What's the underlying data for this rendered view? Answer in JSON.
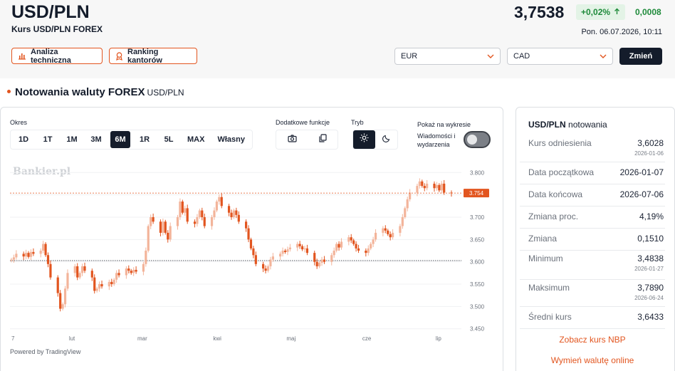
{
  "header": {
    "title": "USD/PLN",
    "subtitle": "Kurs USD/PLN FOREX",
    "price": "3,7538",
    "change_pct": "+0,02%",
    "change_abs": "0,0008",
    "datetime": "Pon. 06.07.2026, 10:11",
    "buttons": {
      "technical_label": "Analiza techniczna",
      "ranking_label": "Ranking kantorów"
    },
    "selects": {
      "from_value": "EUR",
      "to_value": "CAD"
    },
    "change_button_label": "Zmień"
  },
  "section": {
    "title": "Notowania waluty FOREX",
    "pair": "USD/PLN"
  },
  "controls": {
    "period_label": "Okres",
    "periods": [
      "1D",
      "1T",
      "1M",
      "3M",
      "6M",
      "1R",
      "5L",
      "MAX",
      "Własny"
    ],
    "active_period": "6M",
    "functions_label": "Dodatkowe funkcje",
    "mode_label": "Tryb",
    "show_label": "Pokaż na wykresie",
    "show_option": "Wiadomości i wydarzenia",
    "toggle_on": false
  },
  "chart_data": {
    "type": "candlestick",
    "watermark": "Bankier.pl",
    "x_tick_labels": [
      "7",
      "lut",
      "mar",
      "kwi",
      "maj",
      "cze",
      "lip"
    ],
    "y_tick_labels": [
      "3.800",
      "3.750",
      "3.700",
      "3.650",
      "3.600",
      "3.550",
      "3.500",
      "3.450"
    ],
    "ylim": [
      3.44,
      3.81
    ],
    "reference_line": 3.6028,
    "last_price_label": "3.754",
    "up_color": "#f3b49a",
    "down_color": "#e2551f",
    "candles": [
      {
        "date": "2026-01-07",
        "close": 3.605
      },
      {
        "date": "2026-01-08",
        "close": 3.61
      },
      {
        "date": "2026-01-09",
        "close": 3.618
      },
      {
        "date": "2026-01-12",
        "close": 3.612
      },
      {
        "date": "2026-01-13",
        "close": 3.62
      },
      {
        "date": "2026-01-14",
        "close": 3.611
      },
      {
        "date": "2026-01-15",
        "close": 3.622
      },
      {
        "date": "2026-01-16",
        "close": 3.618
      },
      {
        "date": "2026-01-19",
        "close": 3.625
      },
      {
        "date": "2026-01-20",
        "close": 3.64
      },
      {
        "date": "2026-01-21",
        "close": 3.615
      },
      {
        "date": "2026-01-22",
        "close": 3.595
      },
      {
        "date": "2026-01-23",
        "close": 3.565
      },
      {
        "date": "2026-01-26",
        "close": 3.53
      },
      {
        "date": "2026-01-27",
        "close": 3.495
      },
      {
        "date": "2026-01-28",
        "close": 3.505
      },
      {
        "date": "2026-01-29",
        "close": 3.54
      },
      {
        "date": "2026-01-30",
        "close": 3.575
      },
      {
        "date": "2026-02-02",
        "close": 3.59
      },
      {
        "date": "2026-02-03",
        "close": 3.565
      },
      {
        "date": "2026-02-04",
        "close": 3.575
      },
      {
        "date": "2026-02-05",
        "close": 3.59
      },
      {
        "date": "2026-02-06",
        "close": 3.58
      },
      {
        "date": "2026-02-09",
        "close": 3.565
      },
      {
        "date": "2026-02-10",
        "close": 3.535
      },
      {
        "date": "2026-02-11",
        "close": 3.54
      },
      {
        "date": "2026-02-12",
        "close": 3.55
      },
      {
        "date": "2026-02-13",
        "close": 3.545
      },
      {
        "date": "2026-02-16",
        "close": 3.555
      },
      {
        "date": "2026-02-17",
        "close": 3.55
      },
      {
        "date": "2026-02-18",
        "close": 3.56
      },
      {
        "date": "2026-02-19",
        "close": 3.575
      },
      {
        "date": "2026-02-20",
        "close": 3.57
      },
      {
        "date": "2026-02-23",
        "close": 3.585
      },
      {
        "date": "2026-02-24",
        "close": 3.58
      },
      {
        "date": "2026-02-25",
        "close": 3.575
      },
      {
        "date": "2026-02-26",
        "close": 3.582
      },
      {
        "date": "2026-02-27",
        "close": 3.578
      },
      {
        "date": "2026-03-02",
        "close": 3.595
      },
      {
        "date": "2026-03-03",
        "close": 3.625
      },
      {
        "date": "2026-03-04",
        "close": 3.68
      },
      {
        "date": "2026-03-05",
        "close": 3.7
      },
      {
        "date": "2026-03-06",
        "close": 3.69
      },
      {
        "date": "2026-03-09",
        "close": 3.665
      },
      {
        "date": "2026-03-10",
        "close": 3.69
      },
      {
        "date": "2026-03-11",
        "close": 3.665
      },
      {
        "date": "2026-03-12",
        "close": 3.65
      },
      {
        "date": "2026-03-13",
        "close": 3.68
      },
      {
        "date": "2026-03-16",
        "close": 3.7
      },
      {
        "date": "2026-03-17",
        "close": 3.735
      },
      {
        "date": "2026-03-18",
        "close": 3.71
      },
      {
        "date": "2026-03-19",
        "close": 3.72
      },
      {
        "date": "2026-03-20",
        "close": 3.69
      },
      {
        "date": "2026-03-23",
        "close": 3.685
      },
      {
        "date": "2026-03-24",
        "close": 3.7
      },
      {
        "date": "2026-03-25",
        "close": 3.715
      },
      {
        "date": "2026-03-26",
        "close": 3.7
      },
      {
        "date": "2026-03-27",
        "close": 3.68
      },
      {
        "date": "2026-03-30",
        "close": 3.7
      },
      {
        "date": "2026-03-31",
        "close": 3.715
      },
      {
        "date": "2026-04-01",
        "close": 3.735
      },
      {
        "date": "2026-04-02",
        "close": 3.745
      },
      {
        "date": "2026-04-03",
        "close": 3.725
      },
      {
        "date": "2026-04-06",
        "close": 3.71
      },
      {
        "date": "2026-04-07",
        "close": 3.7
      },
      {
        "date": "2026-04-08",
        "close": 3.715
      },
      {
        "date": "2026-04-09",
        "close": 3.705
      },
      {
        "date": "2026-04-10",
        "close": 3.69
      },
      {
        "date": "2026-04-13",
        "close": 3.675
      },
      {
        "date": "2026-04-14",
        "close": 3.65
      },
      {
        "date": "2026-04-15",
        "close": 3.63
      },
      {
        "date": "2026-04-16",
        "close": 3.615
      },
      {
        "date": "2026-04-17",
        "close": 3.595
      },
      {
        "date": "2026-04-20",
        "close": 3.585
      },
      {
        "date": "2026-04-21",
        "close": 3.58
      },
      {
        "date": "2026-04-22",
        "close": 3.59
      },
      {
        "date": "2026-04-23",
        "close": 3.605
      },
      {
        "date": "2026-04-24",
        "close": 3.612
      },
      {
        "date": "2026-04-27",
        "close": 3.618
      },
      {
        "date": "2026-04-28",
        "close": 3.625
      },
      {
        "date": "2026-04-29",
        "close": 3.622
      },
      {
        "date": "2026-04-30",
        "close": 3.628
      },
      {
        "date": "2026-05-01",
        "close": 3.632
      },
      {
        "date": "2026-05-04",
        "close": 3.64
      },
      {
        "date": "2026-05-05",
        "close": 3.635
      },
      {
        "date": "2026-05-06",
        "close": 3.628
      },
      {
        "date": "2026-05-07",
        "close": 3.63
      },
      {
        "date": "2026-05-08",
        "close": 3.62
      },
      {
        "date": "2026-05-11",
        "close": 3.6
      },
      {
        "date": "2026-05-12",
        "close": 3.59
      },
      {
        "date": "2026-05-13",
        "close": 3.598
      },
      {
        "date": "2026-05-14",
        "close": 3.605
      },
      {
        "date": "2026-05-15",
        "close": 3.6
      },
      {
        "date": "2026-05-18",
        "close": 3.615
      },
      {
        "date": "2026-05-19",
        "close": 3.625
      },
      {
        "date": "2026-05-20",
        "close": 3.64
      },
      {
        "date": "2026-05-21",
        "close": 3.632
      },
      {
        "date": "2026-05-22",
        "close": 3.645
      },
      {
        "date": "2026-05-25",
        "close": 3.655
      },
      {
        "date": "2026-05-26",
        "close": 3.648
      },
      {
        "date": "2026-05-27",
        "close": 3.64
      },
      {
        "date": "2026-05-28",
        "close": 3.63
      },
      {
        "date": "2026-05-29",
        "close": 3.625
      },
      {
        "date": "2026-06-01",
        "close": 3.62
      },
      {
        "date": "2026-06-02",
        "close": 3.63
      },
      {
        "date": "2026-06-03",
        "close": 3.64
      },
      {
        "date": "2026-06-04",
        "close": 3.65
      },
      {
        "date": "2026-06-05",
        "close": 3.665
      },
      {
        "date": "2026-06-08",
        "close": 3.675
      },
      {
        "date": "2026-06-09",
        "close": 3.67
      },
      {
        "date": "2026-06-10",
        "close": 3.662
      },
      {
        "date": "2026-06-11",
        "close": 3.655
      },
      {
        "date": "2026-06-12",
        "close": 3.665
      },
      {
        "date": "2026-06-15",
        "close": 3.68
      },
      {
        "date": "2026-06-16",
        "close": 3.7
      },
      {
        "date": "2026-06-17",
        "close": 3.72
      },
      {
        "date": "2026-06-18",
        "close": 3.74
      },
      {
        "date": "2026-06-19",
        "close": 3.755
      },
      {
        "date": "2026-06-22",
        "close": 3.77
      },
      {
        "date": "2026-06-23",
        "close": 3.78
      },
      {
        "date": "2026-06-24",
        "close": 3.77
      },
      {
        "date": "2026-06-25",
        "close": 3.765
      },
      {
        "date": "2026-06-26",
        "close": 3.775
      },
      {
        "date": "2026-06-29",
        "close": 3.765
      },
      {
        "date": "2026-06-30",
        "close": 3.772
      },
      {
        "date": "2026-07-01",
        "close": 3.76
      },
      {
        "date": "2026-07-02",
        "close": 3.775
      },
      {
        "date": "2026-07-03",
        "close": 3.755
      },
      {
        "date": "2026-07-06",
        "close": 3.754
      }
    ]
  },
  "footer": {
    "powered_by": "Powered by TradingView"
  },
  "side": {
    "title_bold": "USD/PLN",
    "title_rest": "notowania",
    "rows": [
      {
        "label": "Kurs odniesienia",
        "value": "3,6028",
        "date": "2026-01-06"
      },
      {
        "label": "Data początkowa",
        "value": "2026-01-07"
      },
      {
        "label": "Data końcowa",
        "value": "2026-07-06"
      },
      {
        "label": "Zmiana proc.",
        "value": "4,19%"
      },
      {
        "label": "Zmiana",
        "value": "0,1510"
      },
      {
        "label": "Minimum",
        "value": "3,4838",
        "date": "2026-01-27"
      },
      {
        "label": "Maksimum",
        "value": "3,7890",
        "date": "2026-06-24"
      },
      {
        "label": "Średni kurs",
        "value": "3,6433"
      }
    ],
    "link_nbp": "Zobacz kurs NBP",
    "link_exchange": "Wymień walutę online"
  }
}
